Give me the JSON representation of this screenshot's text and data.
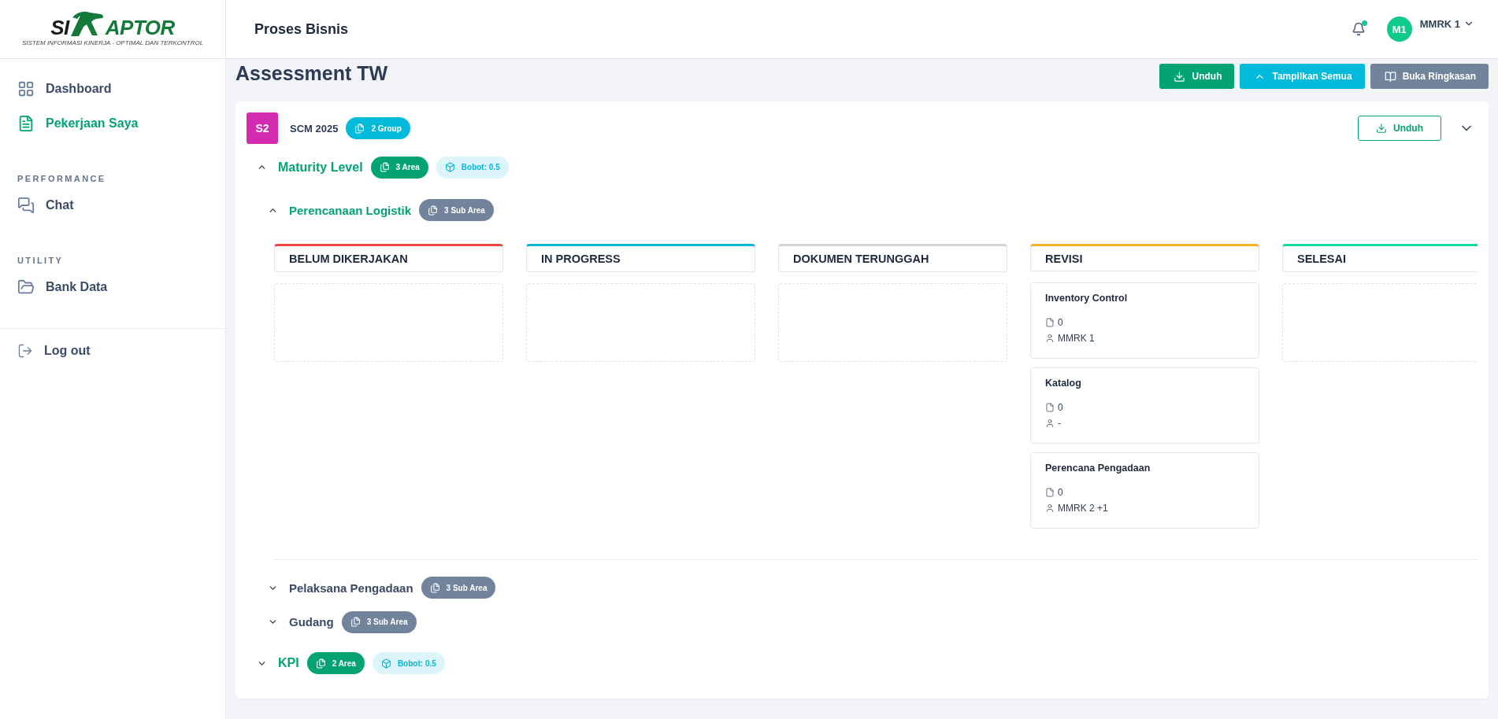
{
  "logo": {
    "left": "SI",
    "right": "APTOR",
    "tagline": "SISTEM INFORMASI KINERJA - OPTIMAL DAN TERKONTROL"
  },
  "sidebar": {
    "sections": [
      {
        "items": [
          {
            "label": "Dashboard",
            "selected": false
          },
          {
            "label": "Pekerjaan Saya",
            "selected": true
          }
        ]
      },
      {
        "heading": "PERFORMANCE",
        "items": [
          {
            "label": "Chat",
            "selected": false
          }
        ]
      },
      {
        "heading": "UTILITY",
        "items": [
          {
            "label": "Bank Data",
            "selected": false
          }
        ]
      }
    ],
    "logout": "Log out"
  },
  "header": {
    "title": "Proses Bisnis",
    "notification_unread": true,
    "user": {
      "initials": "M1",
      "name": "MMRK 1"
    }
  },
  "page": {
    "title": "Assessment TW",
    "actions": [
      {
        "label": "Unduh",
        "kind": "download"
      },
      {
        "label": "Tampilkan Semua",
        "kind": "collapse"
      },
      {
        "label": "Buka Ringkasan",
        "kind": "summary"
      }
    ]
  },
  "group": {
    "code": "S2",
    "name": "SCM 2025",
    "count": "2 Group",
    "download": "Unduh",
    "areas": [
      {
        "name": "Maturity Level",
        "count": "3 Area",
        "weight": "Bobot: 0.5",
        "expanded": true,
        "children": [
          {
            "name": "Perencanaan Logistik",
            "count": "3 Sub Area",
            "expanded": true,
            "columns": [
              {
                "title": "BELUM DIKERJAKAN",
                "color": "#ef4444"
              },
              {
                "title": "IN PROGRESS",
                "color": "#06b6d4"
              },
              {
                "title": "DOKUMEN TERUNGGAH",
                "color": "#d1d5db"
              },
              {
                "title": "REVISI",
                "color": "#f5b324",
                "cards": [
                  {
                    "title": "Inventory Control",
                    "files": "0",
                    "assignee": "MMRK 1"
                  },
                  {
                    "title": "Katalog",
                    "files": "0",
                    "assignee": "-"
                  },
                  {
                    "title": "Perencana Pengadaan",
                    "files": "0",
                    "assignee": "MMRK 2 +1"
                  }
                ]
              },
              {
                "title": "SELESAI",
                "color": "#10d9a0"
              }
            ]
          },
          {
            "name": "Pelaksana Pengadaan",
            "count": "3 Sub Area",
            "expanded": false
          },
          {
            "name": "Gudang",
            "count": "3 Sub Area",
            "expanded": false
          }
        ]
      },
      {
        "name": "KPI",
        "count": "2 Area",
        "weight": "Bobot: 0.5",
        "expanded": false
      }
    ]
  }
}
